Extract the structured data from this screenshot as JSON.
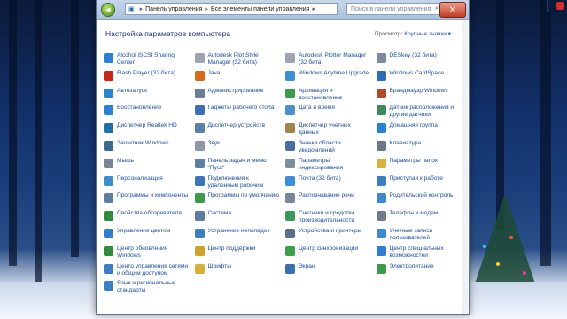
{
  "titlebar": {
    "back_icon": "back-arrow-icon",
    "address": [
      "Панель управления",
      "Все элементы панели управления"
    ],
    "search_placeholder": "Поиск в панели управления",
    "close_symbol": "✕"
  },
  "content": {
    "heading": "Настройка параметров компьютера",
    "view_by_label": "Просмотр:",
    "view_by_value": "Крупные значки ▾"
  },
  "items": [
    {
      "label": "Alcohol iSCSI Sharing Center",
      "icon": "alcohol-icon",
      "color": "#2a7fd6"
    },
    {
      "label": "Autodesk Plot Style Manager (32 бита)",
      "icon": "autodesk-icon",
      "color": "#9aa5b1"
    },
    {
      "label": "Autodesk Plotter Manager (32 бита)",
      "icon": "autodesk-icon",
      "color": "#9aa5b1"
    },
    {
      "label": "DESkey (32 бита)",
      "icon": "deskey-icon",
      "color": "#7b8aa0"
    },
    {
      "label": "Flash Player (32 бита)",
      "icon": "flash-icon",
      "color": "#c9261a"
    },
    {
      "label": "Java",
      "icon": "java-icon",
      "color": "#d96c1b"
    },
    {
      "label": "Windows Anytime Upgrade",
      "icon": "upgrade-icon",
      "color": "#3a8fd8"
    },
    {
      "label": "Windows CardSpace",
      "icon": "cardspace-icon",
      "color": "#2f6ab7"
    },
    {
      "label": "Автозапуск",
      "icon": "autoplay-icon",
      "color": "#2c86c9"
    },
    {
      "label": "Администрирование",
      "icon": "admin-tools-icon",
      "color": "#6e7f95"
    },
    {
      "label": "Архивация и восстановление",
      "icon": "backup-icon",
      "color": "#3d9a4a"
    },
    {
      "label": "Брандмауэр Windows",
      "icon": "firewall-icon",
      "color": "#b04a2a"
    },
    {
      "label": "Восстановление",
      "icon": "recovery-icon",
      "color": "#2a7fd6"
    },
    {
      "label": "Гаджеты рабочего стола",
      "icon": "gadgets-icon",
      "color": "#3a6fb5"
    },
    {
      "label": "Дата и время",
      "icon": "clock-icon",
      "color": "#4a90d0"
    },
    {
      "label": "Датчик расположения и другие датчики",
      "icon": "sensor-icon",
      "color": "#3b8a5a"
    },
    {
      "label": "Диспетчер Realtek HD",
      "icon": "realtek-icon",
      "color": "#1f6fa8"
    },
    {
      "label": "Диспетчер устройств",
      "icon": "device-manager-icon",
      "color": "#5a7fa8"
    },
    {
      "label": "Диспетчер учетных данных",
      "icon": "credentials-icon",
      "color": "#a0844a"
    },
    {
      "label": "Домашняя группа",
      "icon": "homegroup-icon",
      "color": "#2a7fd6"
    },
    {
      "label": "Защитник Windows",
      "icon": "defender-icon",
      "color": "#3a6a8e"
    },
    {
      "label": "Звук",
      "icon": "sound-icon",
      "color": "#8a96a6"
    },
    {
      "label": "Значки области уведомлений",
      "icon": "notification-icon",
      "color": "#4a6fa0"
    },
    {
      "label": "Клавиатура",
      "icon": "keyboard-icon",
      "color": "#6a7789"
    },
    {
      "label": "Мышь",
      "icon": "mouse-icon",
      "color": "#7a8697"
    },
    {
      "label": "Панель задач и меню \"Пуск\"",
      "icon": "taskbar-icon",
      "color": "#5b7fa6"
    },
    {
      "label": "Параметры индексирования",
      "icon": "indexing-icon",
      "color": "#7d8ea3"
    },
    {
      "label": "Параметры папок",
      "icon": "folder-options-icon",
      "color": "#d9b13a"
    },
    {
      "label": "Персонализация",
      "icon": "personalization-icon",
      "color": "#3b8fd0"
    },
    {
      "label": "Подключения к удаленным рабочим",
      "icon": "remote-desktop-icon",
      "color": "#3a76b7"
    },
    {
      "label": "Почта (32 бита)",
      "icon": "mail-icon",
      "color": "#3a8fd8"
    },
    {
      "label": "Приступая к работе",
      "icon": "getting-started-icon",
      "color": "#3d7ec2"
    },
    {
      "label": "Программы и компоненты",
      "icon": "programs-icon",
      "color": "#5e7fa3"
    },
    {
      "label": "Программы по умолчанию",
      "icon": "default-programs-icon",
      "color": "#3a9a4a"
    },
    {
      "label": "Распознавание речи",
      "icon": "microphone-icon",
      "color": "#7a8798"
    },
    {
      "label": "Родительский контроль",
      "icon": "parental-icon",
      "color": "#3b8ad0"
    },
    {
      "label": "Свойства обозревателя",
      "icon": "internet-options-icon",
      "color": "#2f8a3a"
    },
    {
      "label": "Система",
      "icon": "system-icon",
      "color": "#5b7a9d"
    },
    {
      "label": "Счетчики и средства производительности",
      "icon": "performance-icon",
      "color": "#3a9a5a"
    },
    {
      "label": "Телефон и модем",
      "icon": "phone-icon",
      "color": "#6e7c8e"
    },
    {
      "label": "Управление цветом",
      "icon": "color-icon",
      "color": "#2f7fc9"
    },
    {
      "label": "Устранение неполадок",
      "icon": "troubleshoot-icon",
      "color": "#3a7fc0"
    },
    {
      "label": "Устройства и принтеры",
      "icon": "printer-icon",
      "color": "#5b6f88"
    },
    {
      "label": "Учетные записи пользователей",
      "icon": "users-icon",
      "color": "#3a8ad0"
    },
    {
      "label": "Центр обновления Windows",
      "icon": "update-icon",
      "color": "#2f8a3a"
    },
    {
      "label": "Центр поддержки",
      "icon": "action-center-icon",
      "color": "#d0a22a"
    },
    {
      "label": "Центр синхронизации",
      "icon": "sync-icon",
      "color": "#3aa04a"
    },
    {
      "label": "Центр специальных возможностей",
      "icon": "accessibility-icon",
      "color": "#2f7fd0"
    },
    {
      "label": "Центр управления сетями и общим доступом",
      "icon": "network-icon",
      "color": "#3a7fc4"
    },
    {
      "label": "Шрифты",
      "icon": "fonts-icon",
      "color": "#d9b13a"
    },
    {
      "label": "Экран",
      "icon": "display-icon",
      "color": "#3a6fb0"
    },
    {
      "label": "Электропитание",
      "icon": "power-icon",
      "color": "#3a9a4a"
    },
    {
      "label": "Язык и региональные стандарты",
      "icon": "region-icon",
      "color": "#3a7fc4"
    }
  ]
}
